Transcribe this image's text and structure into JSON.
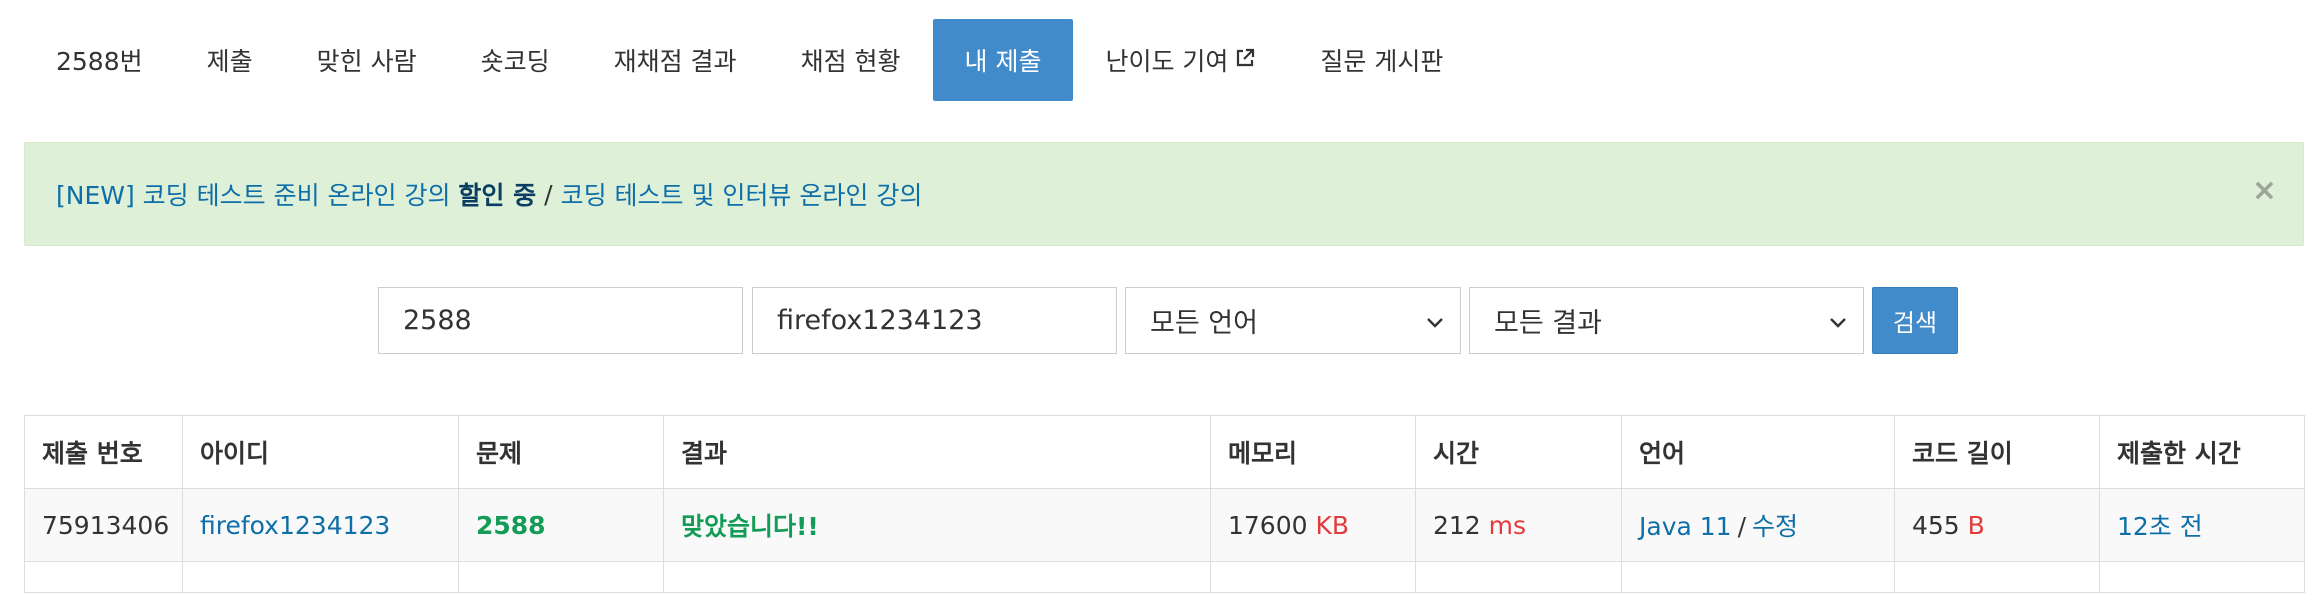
{
  "tabs": [
    {
      "label": "2588번",
      "active": false
    },
    {
      "label": "제출",
      "active": false
    },
    {
      "label": "맞힌 사람",
      "active": false
    },
    {
      "label": "숏코딩",
      "active": false
    },
    {
      "label": "재채점 결과",
      "active": false
    },
    {
      "label": "채점 현황",
      "active": false
    },
    {
      "label": "내 제출",
      "active": true
    },
    {
      "label": "난이도 기여",
      "active": false,
      "icon": "external-link-icon"
    },
    {
      "label": "질문 게시판",
      "active": false
    }
  ],
  "alert": {
    "part1": "[NEW] 코딩 테스트 준비 온라인 강의",
    "part1_strong": "할인 중",
    "separator": "/",
    "part2": "코딩 테스트 및 인터뷰 온라인 강의",
    "close": "×"
  },
  "search": {
    "problem_value": "2588",
    "user_value": "firefox1234123",
    "language_selected": "모든 언어",
    "result_selected": "모든 결과",
    "button_label": "검색"
  },
  "table": {
    "headers": [
      "제출 번호",
      "아이디",
      "문제",
      "결과",
      "메모리",
      "시간",
      "언어",
      "코드 길이",
      "제출한 시간"
    ],
    "rows": [
      {
        "submission_id": "75913406",
        "user": "firefox1234123",
        "problem": "2588",
        "result": "맞았습니다!!",
        "memory": "17600",
        "memory_unit": "KB",
        "time": "212",
        "time_unit": "ms",
        "language": "Java 11",
        "lang_sep": "/",
        "edit": "수정",
        "code_length": "455",
        "code_unit": "B",
        "submitted": "12초 전"
      }
    ]
  },
  "colors": {
    "accent": "#428bca",
    "link": "#0d6ea8",
    "success": "#139c55",
    "unit_red": "#e23b3b",
    "alert_bg": "#dff0d8"
  }
}
